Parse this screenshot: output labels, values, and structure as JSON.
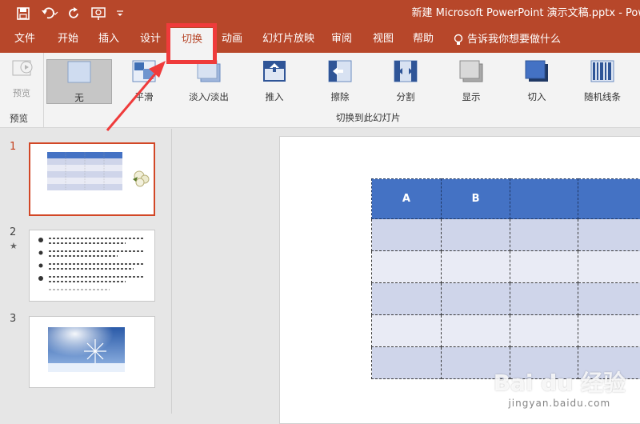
{
  "window": {
    "title": "新建 Microsoft PowerPoint 演示文稿.pptx  -  Pow"
  },
  "tabs": [
    "文件",
    "开始",
    "插入",
    "设计",
    "切换",
    "动画",
    "幻灯片放映",
    "审阅",
    "视图",
    "帮助"
  ],
  "active_tab": "切换",
  "tell_me": "告诉我你想要做什么",
  "ribbon": {
    "preview_label": "预览",
    "preview_group": "预览",
    "transitions_group": "切换到此幻灯片",
    "transitions": [
      "无",
      "平滑",
      "淡入/淡出",
      "推入",
      "擦除",
      "分割",
      "显示",
      "切入",
      "随机线条"
    ],
    "selected_transition": "无"
  },
  "slides": [
    {
      "number": "1",
      "has_animation": false
    },
    {
      "number": "2",
      "has_animation": true,
      "star": "★"
    },
    {
      "number": "3",
      "has_animation": false
    }
  ],
  "table": {
    "headers": [
      "A",
      "B",
      "",
      ""
    ],
    "body_rows": 5
  },
  "colors": {
    "accent": "#b7472a",
    "table_header": "#4472c4",
    "table_band_1": "#cfd5ea",
    "table_band_2": "#e9ebf5",
    "annotation": "#ef3b3b"
  },
  "watermark": {
    "main": "Bai du 经验",
    "sub": "jingyan.baidu.com"
  }
}
